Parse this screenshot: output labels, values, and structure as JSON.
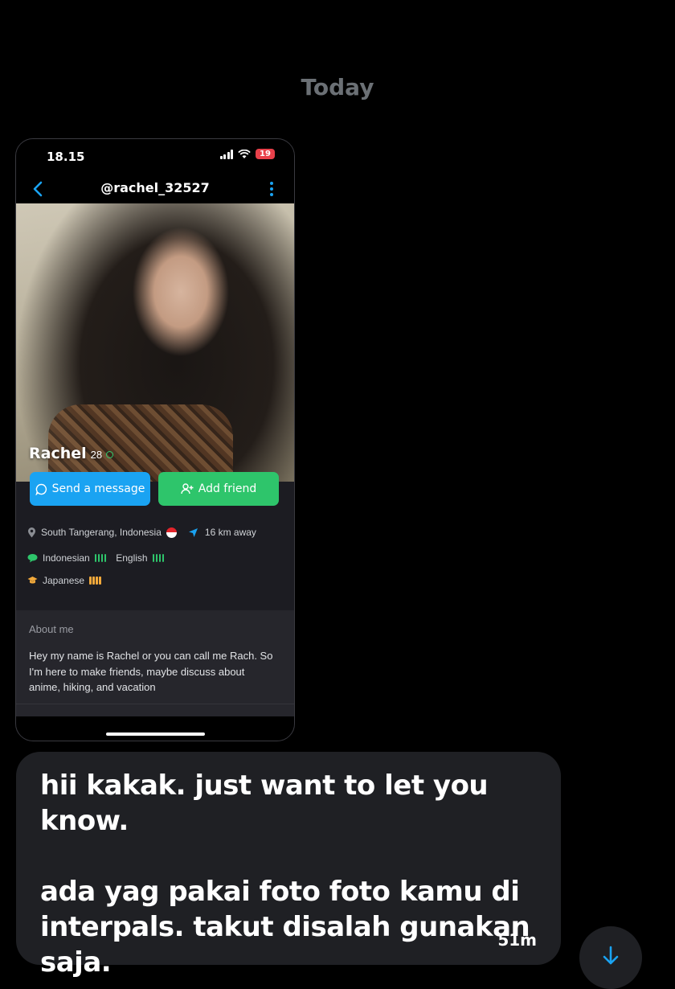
{
  "chat": {
    "date_separator": "Today"
  },
  "shared_screenshot": {
    "status_bar": {
      "time": "18.15",
      "battery": "19"
    },
    "header": {
      "username": "@rachel_32527"
    },
    "profile": {
      "name": "Rachel",
      "age": "28",
      "send_message_label": "Send a message",
      "add_friend_label": "Add friend",
      "location": "South Tangerang, Indonesia",
      "distance": "16 km away",
      "languages": [
        {
          "name": "Indonesian",
          "color": "#2ec56b"
        },
        {
          "name": "English",
          "color": "#2ec56b"
        },
        {
          "name": "Japanese",
          "color": "#f2a93b"
        }
      ],
      "about_title": "About me",
      "about_text": "Hey my name is Rachel or you can call me Rach. So I'm here to make friends, maybe discuss about anime, hiking, and vacation"
    }
  },
  "message": {
    "text": "hii kakak. just want to let you know.\n\nada yag pakai foto foto kamu di interpals. takut disalah gunakan saja.",
    "time": "51m"
  },
  "colors": {
    "background": "#000000",
    "bubble": "#1f2024",
    "accent_blue": "#1aa3f2",
    "accent_green": "#2ec56b"
  }
}
